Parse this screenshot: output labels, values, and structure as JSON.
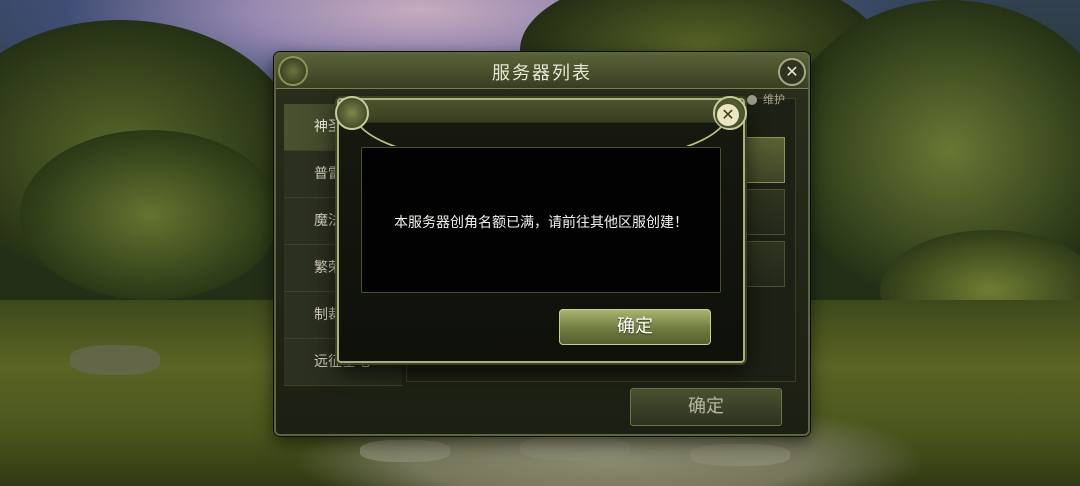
{
  "server_window": {
    "title": "服务器列表",
    "close_icon": "close-icon",
    "tabs": [
      {
        "label": "神圣"
      },
      {
        "label": "普雷利"
      },
      {
        "label": "魔法山"
      },
      {
        "label": "繁荣之"
      },
      {
        "label": "制裁之锤"
      },
      {
        "label": "远征基地"
      }
    ],
    "legend_maintenance": "维护",
    "confirm_label": "确定"
  },
  "modal": {
    "close_icon": "close-icon",
    "message": "本服务器创角名额已满，请前往其他区服创建！",
    "confirm_label": "确定"
  },
  "colors": {
    "accent_green": "#8c9558",
    "button_green": "#a8b56e",
    "frame_gold": "#a9b07a"
  }
}
